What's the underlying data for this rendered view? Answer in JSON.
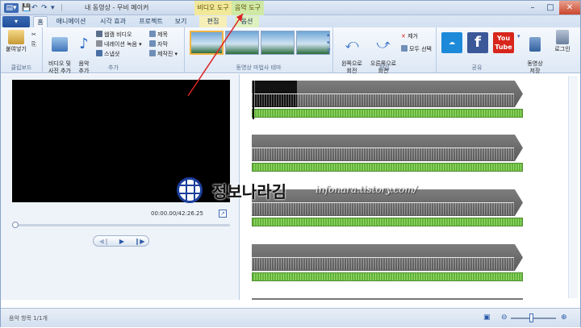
{
  "title_bar": {
    "window_title": "내 동영상 - 무비 메이커",
    "quick_access": [
      "save-icon",
      "undo-icon",
      "redo-icon",
      "dropdown-icon"
    ],
    "context_tabs": [
      {
        "label": "비디오 도구",
        "color": "#f2e89a"
      },
      {
        "label": "음악 도구",
        "color": "#cfe9a5"
      }
    ],
    "window_controls": {
      "minimize": "–",
      "maximize": "□",
      "close": "✕"
    }
  },
  "ribbon_tabs": {
    "file_label": "▾",
    "tabs": [
      {
        "label": "홈",
        "active": true
      },
      {
        "label": "애니메이션"
      },
      {
        "label": "시각 효과"
      },
      {
        "label": "프로젝트"
      },
      {
        "label": "보기"
      },
      {
        "label": "편집"
      },
      {
        "label": "옵션"
      }
    ]
  },
  "ribbon": {
    "clipboard": {
      "paste": "붙여넣기",
      "group": "클립보드"
    },
    "add": {
      "add_video_photo": "비디오 및\n사진 추가",
      "add_music": "음악\n추가",
      "webcam": "웹캠 비디오",
      "narration": "내레이션 녹음",
      "snapshot": "스냅샷",
      "title": "제목",
      "caption": "자막",
      "credits": "제작진",
      "group": "추가"
    },
    "themes": {
      "group": "동영상 마법사 테마",
      "count": 5
    },
    "editing": {
      "rotate_left": "왼쪽으로\n회전",
      "rotate_right": "오른쪽으로\n회전",
      "remove": "제거",
      "select_all": "모두 선택",
      "group": "편집"
    },
    "share": {
      "services": [
        {
          "name": "skydrive-icon",
          "label": "",
          "color": "#1c8ad9"
        },
        {
          "name": "facebook-icon",
          "label": "f",
          "color": "#3b5998"
        },
        {
          "name": "youtube-icon",
          "label": "You\nTube",
          "color": "#d8261c"
        }
      ],
      "save_movie": "동영상\n저장",
      "signin": "로그인",
      "group": "공유"
    }
  },
  "preview": {
    "timecode": "00:00.00/42:26.25"
  },
  "status_bar": {
    "text": "음악 항목 1/1개",
    "zoom_out": "⊖",
    "zoom_in": "⊕",
    "zoom_level": 0.45
  },
  "watermark": {
    "brand": "정보나라김",
    "url": "infonara.tistory.com/"
  },
  "colors": {
    "accent": "#3d6bb5",
    "audio_green": "#62b43a",
    "clip_gray": "#6a6a6a"
  }
}
